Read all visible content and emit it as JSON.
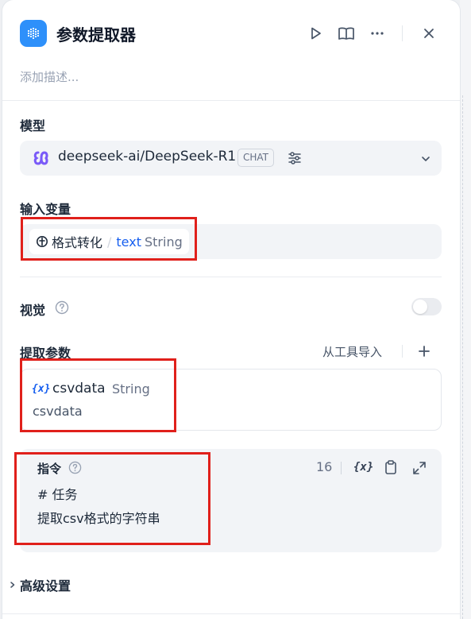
{
  "header": {
    "title": "参数提取器",
    "description_placeholder": "添加描述..."
  },
  "model": {
    "label": "模型",
    "name": "deepseek-ai/DeepSeek-R1",
    "badge": "CHAT"
  },
  "input_variables": {
    "label": "输入变量",
    "node": "格式转化",
    "separator": "/",
    "var_name": "text",
    "var_type": "String"
  },
  "vision": {
    "label": "视觉",
    "enabled": false
  },
  "extract_params": {
    "label": "提取参数",
    "import_link": "从工具导入",
    "items": [
      {
        "icon": "{x}",
        "name": "csvdata",
        "type": "String",
        "description": "csvdata"
      }
    ]
  },
  "instruction": {
    "label": "指令",
    "count": "16",
    "var_icon": "{x}",
    "line1": "# 任务",
    "line2": "提取csv格式的字符串"
  },
  "advanced": {
    "label": "高级设置"
  },
  "colors": {
    "accent": "#155eef",
    "app_icon": "#2e90fa",
    "annotation_red": "#e0201b"
  }
}
